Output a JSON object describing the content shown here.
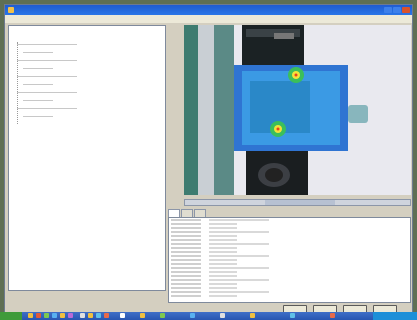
{
  "window": {
    "title": ""
  },
  "menu": [],
  "tree": {
    "header": "",
    "items": []
  },
  "viewer": {
    "scroll_label": ""
  },
  "tabs": [
    "",
    "",
    ""
  ],
  "properties": [],
  "buttons": {
    "ok": "",
    "cancel": "",
    "apply": "",
    "help": ""
  },
  "taskbar": {
    "start": ""
  },
  "colors": {
    "titlebar": "#2a76e8",
    "thermal_overlay": "#2f8fd6",
    "hotspot": "#f2e23a",
    "taskbar": "#2855b1"
  },
  "icons": [
    "app-icon",
    "minimize-icon",
    "maximize-icon",
    "close-icon",
    "start-icon"
  ]
}
